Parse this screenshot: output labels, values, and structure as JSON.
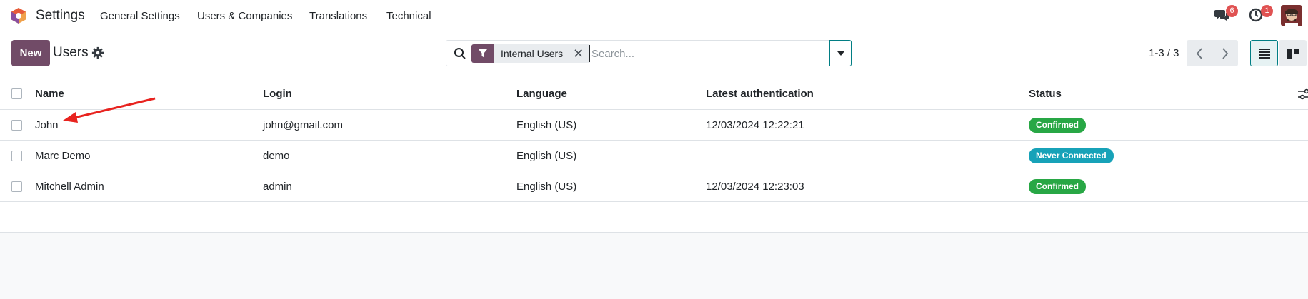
{
  "navbar": {
    "app_title": "Settings",
    "menu": [
      "General Settings",
      "Users & Companies",
      "Translations",
      "Technical"
    ],
    "chat_badge": "6",
    "activity_badge": "1"
  },
  "control": {
    "new_label": "New",
    "page_title": "Users",
    "facet_label": "Internal Users",
    "search_placeholder": "Search...",
    "pager": "1-3 / 3"
  },
  "table": {
    "columns": [
      "Name",
      "Login",
      "Language",
      "Latest authentication",
      "Status"
    ],
    "rows": [
      {
        "name": "John",
        "login": "john@gmail.com",
        "language": "English (US)",
        "latest_auth": "12/03/2024 12:22:21",
        "status": "Confirmed",
        "status_color": "#28a745"
      },
      {
        "name": "Marc Demo",
        "login": "demo",
        "language": "English (US)",
        "latest_auth": "",
        "status": "Never Connected",
        "status_color": "#17a2b8"
      },
      {
        "name": "Mitchell Admin",
        "login": "admin",
        "language": "English (US)",
        "latest_auth": "12/03/2024 12:23:03",
        "status": "Confirmed",
        "status_color": "#28a745"
      }
    ]
  },
  "colors": {
    "brand": "#714b67",
    "accent": "#017e84",
    "annotation_arrow": "#e8231f"
  },
  "icons": [
    "app-logo-icon",
    "chat-icon",
    "clock-icon",
    "gear-icon",
    "search-icon",
    "filter-icon",
    "close-icon",
    "caret-down-icon",
    "chevron-left-icon",
    "chevron-right-icon",
    "list-view-icon",
    "kanban-view-icon",
    "column-options-icon"
  ]
}
